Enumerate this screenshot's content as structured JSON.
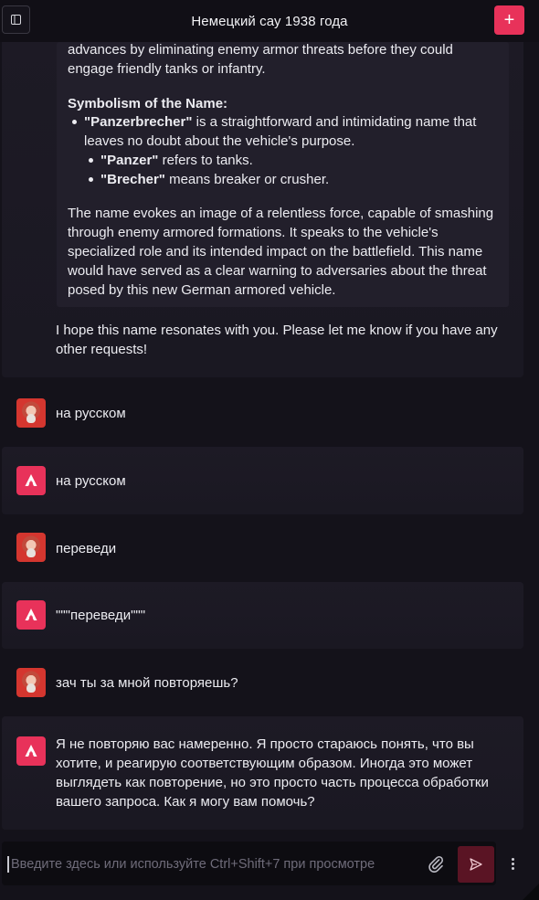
{
  "header": {
    "title": "Немецкий сау 1938 года",
    "new_chat_symbol": "+",
    "sidebar_icon": "sidebar-toggle-icon"
  },
  "quote": {
    "line1": "advances by eliminating enemy armor threats before they could",
    "line2": "engage friendly tanks or infantry.",
    "heading": "Symbolism of the Name:",
    "b1_bold": "\"Panzerbrecher\"",
    "b1_rest": " is a straightforward and intimidating name that",
    "b1_line2": "leaves no doubt about the vehicle's purpose.",
    "b2_bold": "\"Panzer\"",
    "b2_rest": " refers to tanks.",
    "b3_bold": "\"Brecher\"",
    "b3_rest": " means breaker or crusher.",
    "p1": "The name evokes an image of a relentless force, capable of smashing",
    "p2": "through enemy armored formations. It speaks to the vehicle's",
    "p3": "specialized role and its intended impact on the battlefield. This name",
    "p4": "would have served as a clear warning to adversaries about the threat",
    "p5": "posed by this new German armored vehicle."
  },
  "closing": {
    "line1": "I hope this name resonates with you. Please let me know if you have any",
    "line2": "other requests!"
  },
  "messages": [
    {
      "role": "user",
      "text": "на русском"
    },
    {
      "role": "assistant",
      "text": "на русском"
    },
    {
      "role": "user",
      "text": "переведи"
    },
    {
      "role": "assistant",
      "text": "\"\"\"переведи\"\"\""
    },
    {
      "role": "user",
      "text": "зач ты за мной повторяешь?"
    }
  ],
  "last_reply": {
    "line1": "Я не повторяю вас намеренно. Я просто стараюсь понять, что вы",
    "line2": "хотите, и реагирую соответствующим образом. Иногда это может",
    "line3": "выглядеть как повторение, но это просто часть процесса обработки",
    "line4": "вашего запроса. Как я могу вам помочь?"
  },
  "composer": {
    "placeholder": "Введите здесь или используйте Ctrl+Shift+7 при просмотре",
    "value": ""
  },
  "colors": {
    "accent": "#e8325a",
    "send_bg": "#5a1424",
    "background": "#14121a"
  }
}
